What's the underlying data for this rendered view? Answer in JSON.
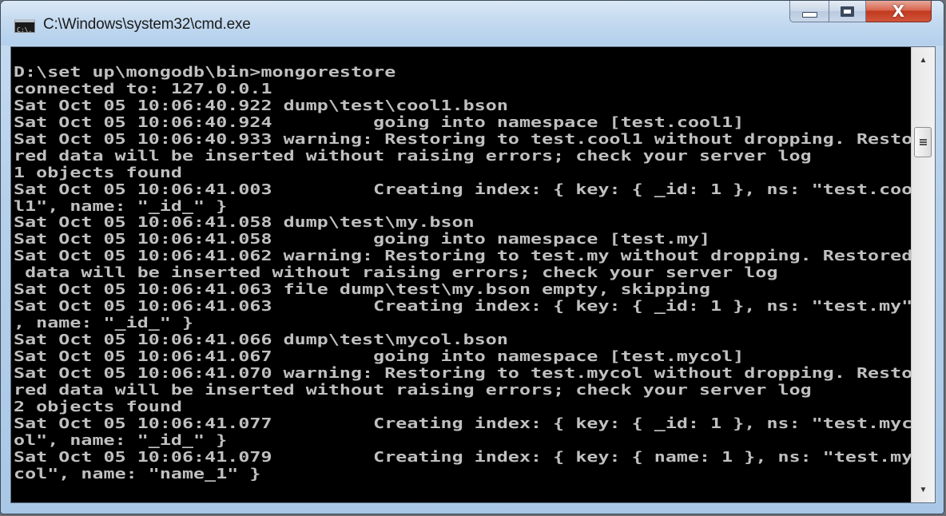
{
  "window": {
    "title": "C:\\Windows\\system32\\cmd.exe",
    "app_icon_text": "C:\\."
  },
  "caption_buttons": {
    "minimize": "minimize",
    "maximize": "maximize",
    "close": "X"
  },
  "console": {
    "lines": [
      "D:\\set up\\mongodb\\bin>mongorestore",
      "connected to: 127.0.0.1",
      "Sat Oct 05 10:06:40.922 dump\\test\\cool1.bson",
      "Sat Oct 05 10:06:40.924         going into namespace [test.cool1]",
      "Sat Oct 05 10:06:40.933 warning: Restoring to test.cool1 without dropping. Resto",
      "red data will be inserted without raising errors; check your server log",
      "1 objects found",
      "Sat Oct 05 10:06:41.003         Creating index: { key: { _id: 1 }, ns: \"test.coo",
      "l1\", name: \"_id_\" }",
      "Sat Oct 05 10:06:41.058 dump\\test\\my.bson",
      "Sat Oct 05 10:06:41.058         going into namespace [test.my]",
      "Sat Oct 05 10:06:41.062 warning: Restoring to test.my without dropping. Restored",
      " data will be inserted without raising errors; check your server log",
      "Sat Oct 05 10:06:41.063 file dump\\test\\my.bson empty, skipping",
      "Sat Oct 05 10:06:41.063         Creating index: { key: { _id: 1 }, ns: \"test.my\"",
      ", name: \"_id_\" }",
      "Sat Oct 05 10:06:41.066 dump\\test\\mycol.bson",
      "Sat Oct 05 10:06:41.067         going into namespace [test.mycol]",
      "Sat Oct 05 10:06:41.070 warning: Restoring to test.mycol without dropping. Resto",
      "red data will be inserted without raising errors; check your server log",
      "2 objects found",
      "Sat Oct 05 10:06:41.077         Creating index: { key: { _id: 1 }, ns: \"test.myc",
      "ol\", name: \"_id_\" }",
      "Sat Oct 05 10:06:41.079         Creating index: { key: { name: 1 }, ns: \"test.my",
      "col\", name: \"name_1\" }",
      ""
    ]
  },
  "scrollbar": {
    "up_glyph": "▲",
    "down_glyph": "▼"
  },
  "colors": {
    "console_bg": "#000000",
    "console_fg": "#c0c0c0",
    "close_button": "#c7432a"
  }
}
